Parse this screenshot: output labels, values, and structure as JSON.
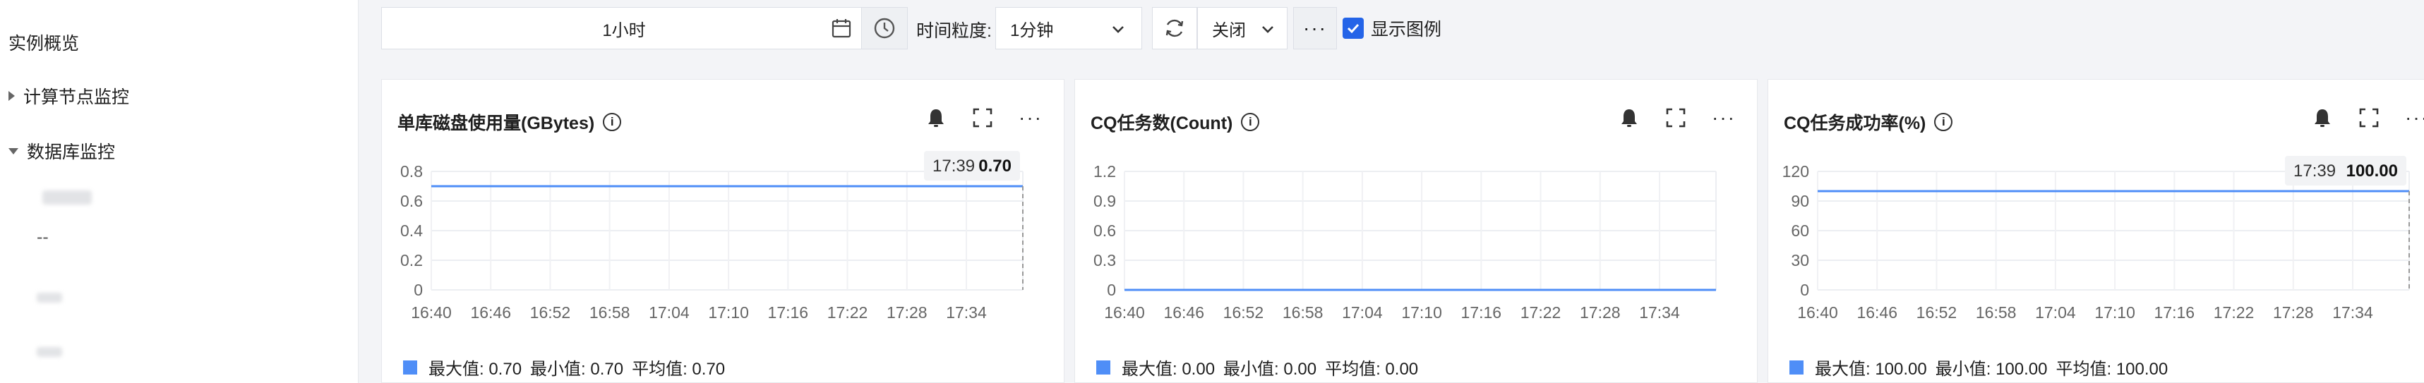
{
  "sidebar": {
    "overview": "实例概览",
    "compute_monitor": "计算节点监控",
    "db_monitor": "数据库监控",
    "sub_items": [
      "",
      "--",
      "",
      ""
    ]
  },
  "toolbar": {
    "time_range": "1小时",
    "granularity_label": "时间粒度:",
    "granularity": "1分钟",
    "auto_refresh": "关闭",
    "show_legend": "显示图例"
  },
  "panels": [
    {
      "title": "单库磁盘使用量(GBytes)",
      "tooltip_time": "17:39",
      "tooltip_value": "0.70",
      "stats": {
        "max": "最大值: 0.70",
        "min": "最小值: 0.70",
        "avg": "平均值: 0.70"
      }
    },
    {
      "title": "CQ任务数(Count)",
      "stats": {
        "max": "最大值: 0.00",
        "min": "最小值: 0.00",
        "avg": "平均值: 0.00"
      }
    },
    {
      "title": "CQ任务成功率(%)",
      "tooltip_time": "17:39",
      "tooltip_value": "100.00",
      "stats": {
        "max": "最大值: 100.00",
        "min": "最小值: 100.00",
        "avg": "平均值: 100.00"
      }
    }
  ],
  "colors": {
    "series": "#4f8ef7",
    "accent": "#2464e8"
  },
  "chart_data": [
    {
      "type": "line",
      "title": "单库磁盘使用量(GBytes)",
      "x_ticks": [
        "16:40",
        "16:46",
        "16:52",
        "16:58",
        "17:04",
        "17:10",
        "17:16",
        "17:22",
        "17:28",
        "17:34"
      ],
      "y_ticks": [
        "0",
        "0.2",
        "0.4",
        "0.6",
        "0.8"
      ],
      "ylim": [
        0,
        0.8
      ],
      "series": [
        {
          "values": [
            0.7,
            0.7
          ]
        }
      ],
      "grid": true
    },
    {
      "type": "line",
      "title": "CQ任务数(Count)",
      "x_ticks": [
        "16:40",
        "16:46",
        "16:52",
        "16:58",
        "17:04",
        "17:10",
        "17:16",
        "17:22",
        "17:28",
        "17:34"
      ],
      "y_ticks": [
        "0",
        "0.3",
        "0.6",
        "0.9",
        "1.2"
      ],
      "ylim": [
        0,
        1.2
      ],
      "series": [
        {
          "values": [
            0.0,
            0.0
          ]
        }
      ],
      "grid": true
    },
    {
      "type": "line",
      "title": "CQ任务成功率(%)",
      "x_ticks": [
        "16:40",
        "16:46",
        "16:52",
        "16:58",
        "17:04",
        "17:10",
        "17:16",
        "17:22",
        "17:28",
        "17:34"
      ],
      "y_ticks": [
        "0",
        "30",
        "60",
        "90",
        "120"
      ],
      "ylim": [
        0,
        120
      ],
      "series": [
        {
          "values": [
            100.0,
            100.0
          ]
        }
      ],
      "grid": true
    }
  ]
}
